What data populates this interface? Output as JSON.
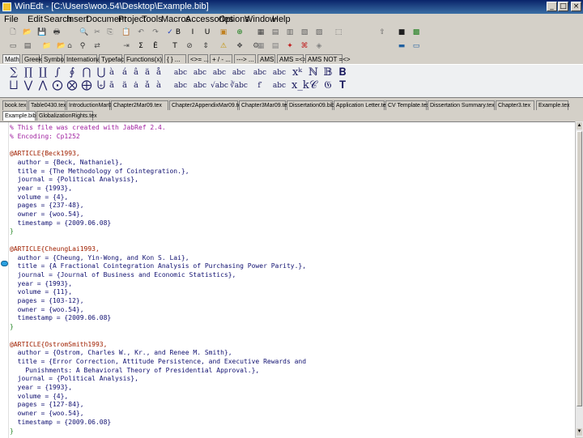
{
  "window": {
    "title": "WinEdt - [C:\\Users\\woo.54\\Desktop\\Example.bib]",
    "min_glyph": "_",
    "max_glyph": "□",
    "close_glyph": "×"
  },
  "menu": [
    "File",
    "Edit",
    "Search",
    "Insert",
    "Document",
    "Project",
    "Tools",
    "Macros",
    "Accessories",
    "Options",
    "Window",
    "Help"
  ],
  "toolbar1": [
    {
      "name": "new-file-icon",
      "glyph": "🗋",
      "color": "#606060"
    },
    {
      "name": "open-folder-icon",
      "glyph": "📂",
      "color": "#c8a020"
    },
    {
      "name": "save-icon",
      "glyph": "💾",
      "color": "#303090"
    },
    {
      "name": "print-icon",
      "glyph": "🖶",
      "color": "#404040"
    },
    {
      "name": "find-icon",
      "glyph": "🔍",
      "color": "#303030"
    },
    {
      "name": "cut-icon",
      "glyph": "✂",
      "color": "#707070"
    },
    {
      "name": "copy-icon",
      "glyph": "⎘",
      "color": "#707070"
    },
    {
      "name": "paste-icon",
      "glyph": "📋",
      "color": "#707070"
    },
    {
      "name": "undo-icon",
      "glyph": "↶",
      "color": "#707070"
    },
    {
      "name": "redo-icon",
      "glyph": "↷",
      "color": "#707070"
    },
    {
      "name": "spell-check-icon",
      "glyph": "✓",
      "color": "#2040c0"
    },
    {
      "name": "bold-icon",
      "glyph": "B",
      "color": "#000000"
    },
    {
      "name": "italic-icon",
      "glyph": "I",
      "color": "#000000"
    },
    {
      "name": "underline-icon",
      "glyph": "U",
      "color": "#000000"
    },
    {
      "name": "highlight-icon",
      "glyph": "▣",
      "color": "#c08020"
    },
    {
      "name": "search-web-icon",
      "glyph": "⊕",
      "color": "#208020"
    },
    {
      "name": "tex-compile-icon",
      "glyph": "▦",
      "color": "#404040"
    },
    {
      "name": "latex-icon",
      "glyph": "▤",
      "color": "#606060"
    },
    {
      "name": "yap-icon",
      "glyph": "▥",
      "color": "#606060"
    },
    {
      "name": "dvi-icon",
      "glyph": "▧",
      "color": "#606060"
    },
    {
      "name": "pdf-icon",
      "glyph": "▨",
      "color": "#606060"
    },
    {
      "name": "project-icon",
      "glyph": "⬚",
      "color": "#606060"
    },
    {
      "name": "export-icon",
      "glyph": "⇧",
      "color": "#606060"
    },
    {
      "name": "console-icon",
      "glyph": "■",
      "color": "#202020"
    },
    {
      "name": "image-icon",
      "glyph": "▩",
      "color": "#208020"
    }
  ],
  "toolbar2": [
    {
      "name": "floppy-icon",
      "glyph": "▭",
      "color": "#505050"
    },
    {
      "name": "printer-icon",
      "glyph": "▤",
      "color": "#505050"
    },
    {
      "name": "folder-green-icon",
      "glyph": "📁",
      "color": "#208040"
    },
    {
      "name": "folder-open-icon",
      "glyph": "📂",
      "color": "#c8a020"
    },
    {
      "name": "tree-icon",
      "glyph": "⌂",
      "color": "#505050"
    },
    {
      "name": "binoculars-icon",
      "glyph": "⚲",
      "color": "#303030"
    },
    {
      "name": "replace-icon",
      "glyph": "⇄",
      "color": "#505050"
    },
    {
      "name": "goto-icon",
      "glyph": "⇥",
      "color": "#505050"
    },
    {
      "name": "sum-icon",
      "glyph": "Σ",
      "color": "#000000"
    },
    {
      "name": "accent-e-icon",
      "glyph": "Ê",
      "color": "#000000"
    },
    {
      "name": "typewriter-icon",
      "glyph": "T",
      "color": "#000000"
    },
    {
      "name": "zoom-icon",
      "glyph": "⊘",
      "color": "#404040"
    },
    {
      "name": "ruler-icon",
      "glyph": "⇕",
      "color": "#404040"
    },
    {
      "name": "warning-icon",
      "glyph": "⚠",
      "color": "#c09000"
    },
    {
      "name": "bookmark-icon",
      "glyph": "❖",
      "color": "#505050"
    },
    {
      "name": "tools-icon",
      "glyph": "⚙",
      "color": "#505050"
    },
    {
      "name": "grid-icon",
      "glyph": "▦",
      "color": "#808080"
    },
    {
      "name": "table-icon",
      "glyph": "▤",
      "color": "#808080"
    },
    {
      "name": "pdflatex-icon",
      "glyph": "✦",
      "color": "#c02020"
    },
    {
      "name": "acrobat-icon",
      "glyph": "⌘",
      "color": "#c02020"
    },
    {
      "name": "gsview-icon",
      "glyph": "◈",
      "color": "#808080"
    },
    {
      "name": "terminal-icon",
      "glyph": "▬",
      "color": "#2060a0"
    },
    {
      "name": "window-icon",
      "glyph": "▭",
      "color": "#2060a0"
    }
  ],
  "math_tabs": [
    "Math",
    "Greek",
    "Symbols",
    "International",
    "Typeface",
    "Functions(x) ...",
    "{ } ...",
    "<>= ...",
    "+ / - ...",
    "---> ...",
    "AMS",
    "AMS =<>",
    "AMS NOT =<>"
  ],
  "palette_row1": [
    "∑",
    "∏",
    "∐",
    "∫",
    "∮",
    "⋂",
    "⋃",
    "à",
    "á",
    "â",
    "ä",
    "å",
    "abc",
    "abc",
    "abc",
    "abc",
    "abc",
    "abc",
    "xᵏ",
    "ℕ",
    "𝔹",
    "𝐁"
  ],
  "palette_row2": [
    "⨆",
    "⋁",
    "⋀",
    "⨀",
    "⨂",
    "⨁",
    "⨄",
    "ā",
    "ä",
    "ȧ",
    "ǎ",
    "à",
    "abc",
    "abc",
    "√abc",
    "∛abc",
    "f′",
    "abc",
    "x_k",
    "𝒞",
    "𝔊",
    "𝐓"
  ],
  "doc_tabs": [
    "book.tex",
    "Table0430.tex",
    "IntroductionMar09.tex",
    "Chapter2Mar09.tex",
    "Chapter2AppendixMar09.tex",
    "Chapter3Mar09.tex",
    "Dissertation09.bib",
    "Application Letter.tex",
    "CV Template.tex",
    "Dissertation Summary.tex",
    "Chapter3.tex",
    "Example.tex"
  ],
  "doc_tabs_row2": [
    "Example.bib",
    "GlobalizationRights.tex"
  ],
  "editor_lines": [
    {
      "t": "% This file was created with JabRef 2.4.",
      "c": "cm"
    },
    {
      "t": "% Encoding: Cp1252",
      "c": "cm"
    },
    {
      "t": "",
      "c": "tx"
    },
    {
      "t": "@ARTICLE{Beck1993,",
      "c": "kw"
    },
    {
      "t": "  author = {Beck, Nathaniel},",
      "c": "tx"
    },
    {
      "t": "  title = {The Methodology of Cointegration.},",
      "c": "tx"
    },
    {
      "t": "  journal = {Political Analysis},",
      "c": "tx"
    },
    {
      "t": "  year = {1993},",
      "c": "tx"
    },
    {
      "t": "  volume = {4},",
      "c": "tx"
    },
    {
      "t": "  pages = {237-48},",
      "c": "tx"
    },
    {
      "t": "  owner = {woo.54},",
      "c": "tx"
    },
    {
      "t": "  timestamp = {2009.06.08}",
      "c": "tx"
    },
    {
      "t": "}",
      "c": "br"
    },
    {
      "t": "",
      "c": "tx"
    },
    {
      "t": "@ARTICLE{CheungLai1993,",
      "c": "kw"
    },
    {
      "t": "  author = {Cheung, Yin-Wong, and Kon S. Lai},",
      "c": "tx"
    },
    {
      "t": "  title = {A Fractional Cointegration Analysis of Purchasing Power Parity.},",
      "c": "tx"
    },
    {
      "t": "  journal = {Journal of Business and Economic Statistics},",
      "c": "tx"
    },
    {
      "t": "  year = {1993},",
      "c": "tx"
    },
    {
      "t": "  volume = {11},",
      "c": "tx"
    },
    {
      "t": "  pages = {103-12},",
      "c": "tx"
    },
    {
      "t": "  owner = {woo.54},",
      "c": "tx"
    },
    {
      "t": "  timestamp = {2009.06.08}",
      "c": "tx"
    },
    {
      "t": "}",
      "c": "br"
    },
    {
      "t": "",
      "c": "tx"
    },
    {
      "t": "@ARTICLE{OstromSmith1993,",
      "c": "kw"
    },
    {
      "t": "  author = {Ostrom, Charles W., Kr., and Renee M. Smith},",
      "c": "tx"
    },
    {
      "t": "  title = {Error Correction, Attitude Persistence, and Executive Rewards and",
      "c": "tx"
    },
    {
      "t": "    Punishments: A Behavioral Theory of Presidential Approval.},",
      "c": "tx"
    },
    {
      "t": "  journal = {Political Analysis},",
      "c": "tx"
    },
    {
      "t": "  year = {1993},",
      "c": "tx"
    },
    {
      "t": "  volume = {4},",
      "c": "tx"
    },
    {
      "t": "  pages = {127-84},",
      "c": "tx"
    },
    {
      "t": "  owner = {woo.54},",
      "c": "tx"
    },
    {
      "t": "  timestamp = {2009.06.08}",
      "c": "tx"
    },
    {
      "t": "}",
      "c": "br"
    }
  ]
}
